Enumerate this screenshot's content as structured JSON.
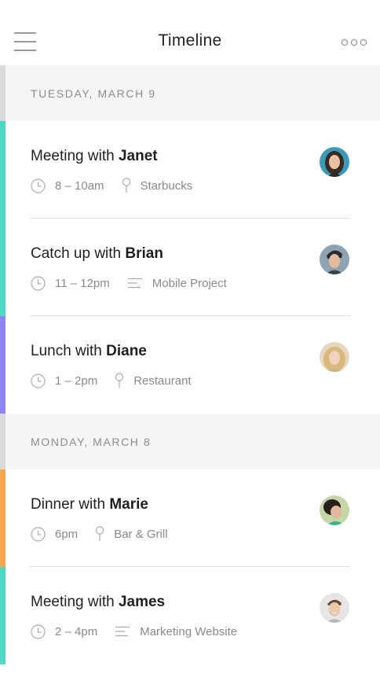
{
  "header": {
    "title": "Timeline",
    "menu_icon": "hamburger-menu-icon",
    "more_icon": "more-dots-icon"
  },
  "days": [
    {
      "label": "TUESDAY, MARCH 9",
      "events": [
        {
          "prefix": "Meeting with",
          "person": "Janet",
          "time": "8 – 10am",
          "secondary_icon": "location-pin-icon",
          "secondary": "Starbucks",
          "accent": "#4fd8c2"
        },
        {
          "prefix": "Catch up with",
          "person": "Brian",
          "time": "11 – 12pm",
          "secondary_icon": "notes-lines-icon",
          "secondary": "Mobile Project",
          "accent": "#4fd8c2"
        },
        {
          "prefix": "Lunch with",
          "person": "Diane",
          "time": "1 – 2pm",
          "secondary_icon": "location-pin-icon",
          "secondary": "Restaurant",
          "accent": "#8f86f5"
        }
      ]
    },
    {
      "label": "MONDAY, MARCH 8",
      "events": [
        {
          "prefix": "Dinner with",
          "person": "Marie",
          "time": "6pm",
          "secondary_icon": "location-pin-icon",
          "secondary": "Bar & Grill",
          "accent": "#ffa64d"
        },
        {
          "prefix": "Meeting with",
          "person": "James",
          "time": "2 – 4pm",
          "secondary_icon": "notes-lines-icon",
          "secondary": "Marketing Website",
          "accent": "#4fd8c2"
        }
      ]
    }
  ],
  "colors": {
    "turquoise": "#4fd8c2",
    "purple": "#8f86f5",
    "orange": "#ffa64d",
    "day_header_bg": "#f5f5f5",
    "meta_text": "#8a8a8a"
  }
}
